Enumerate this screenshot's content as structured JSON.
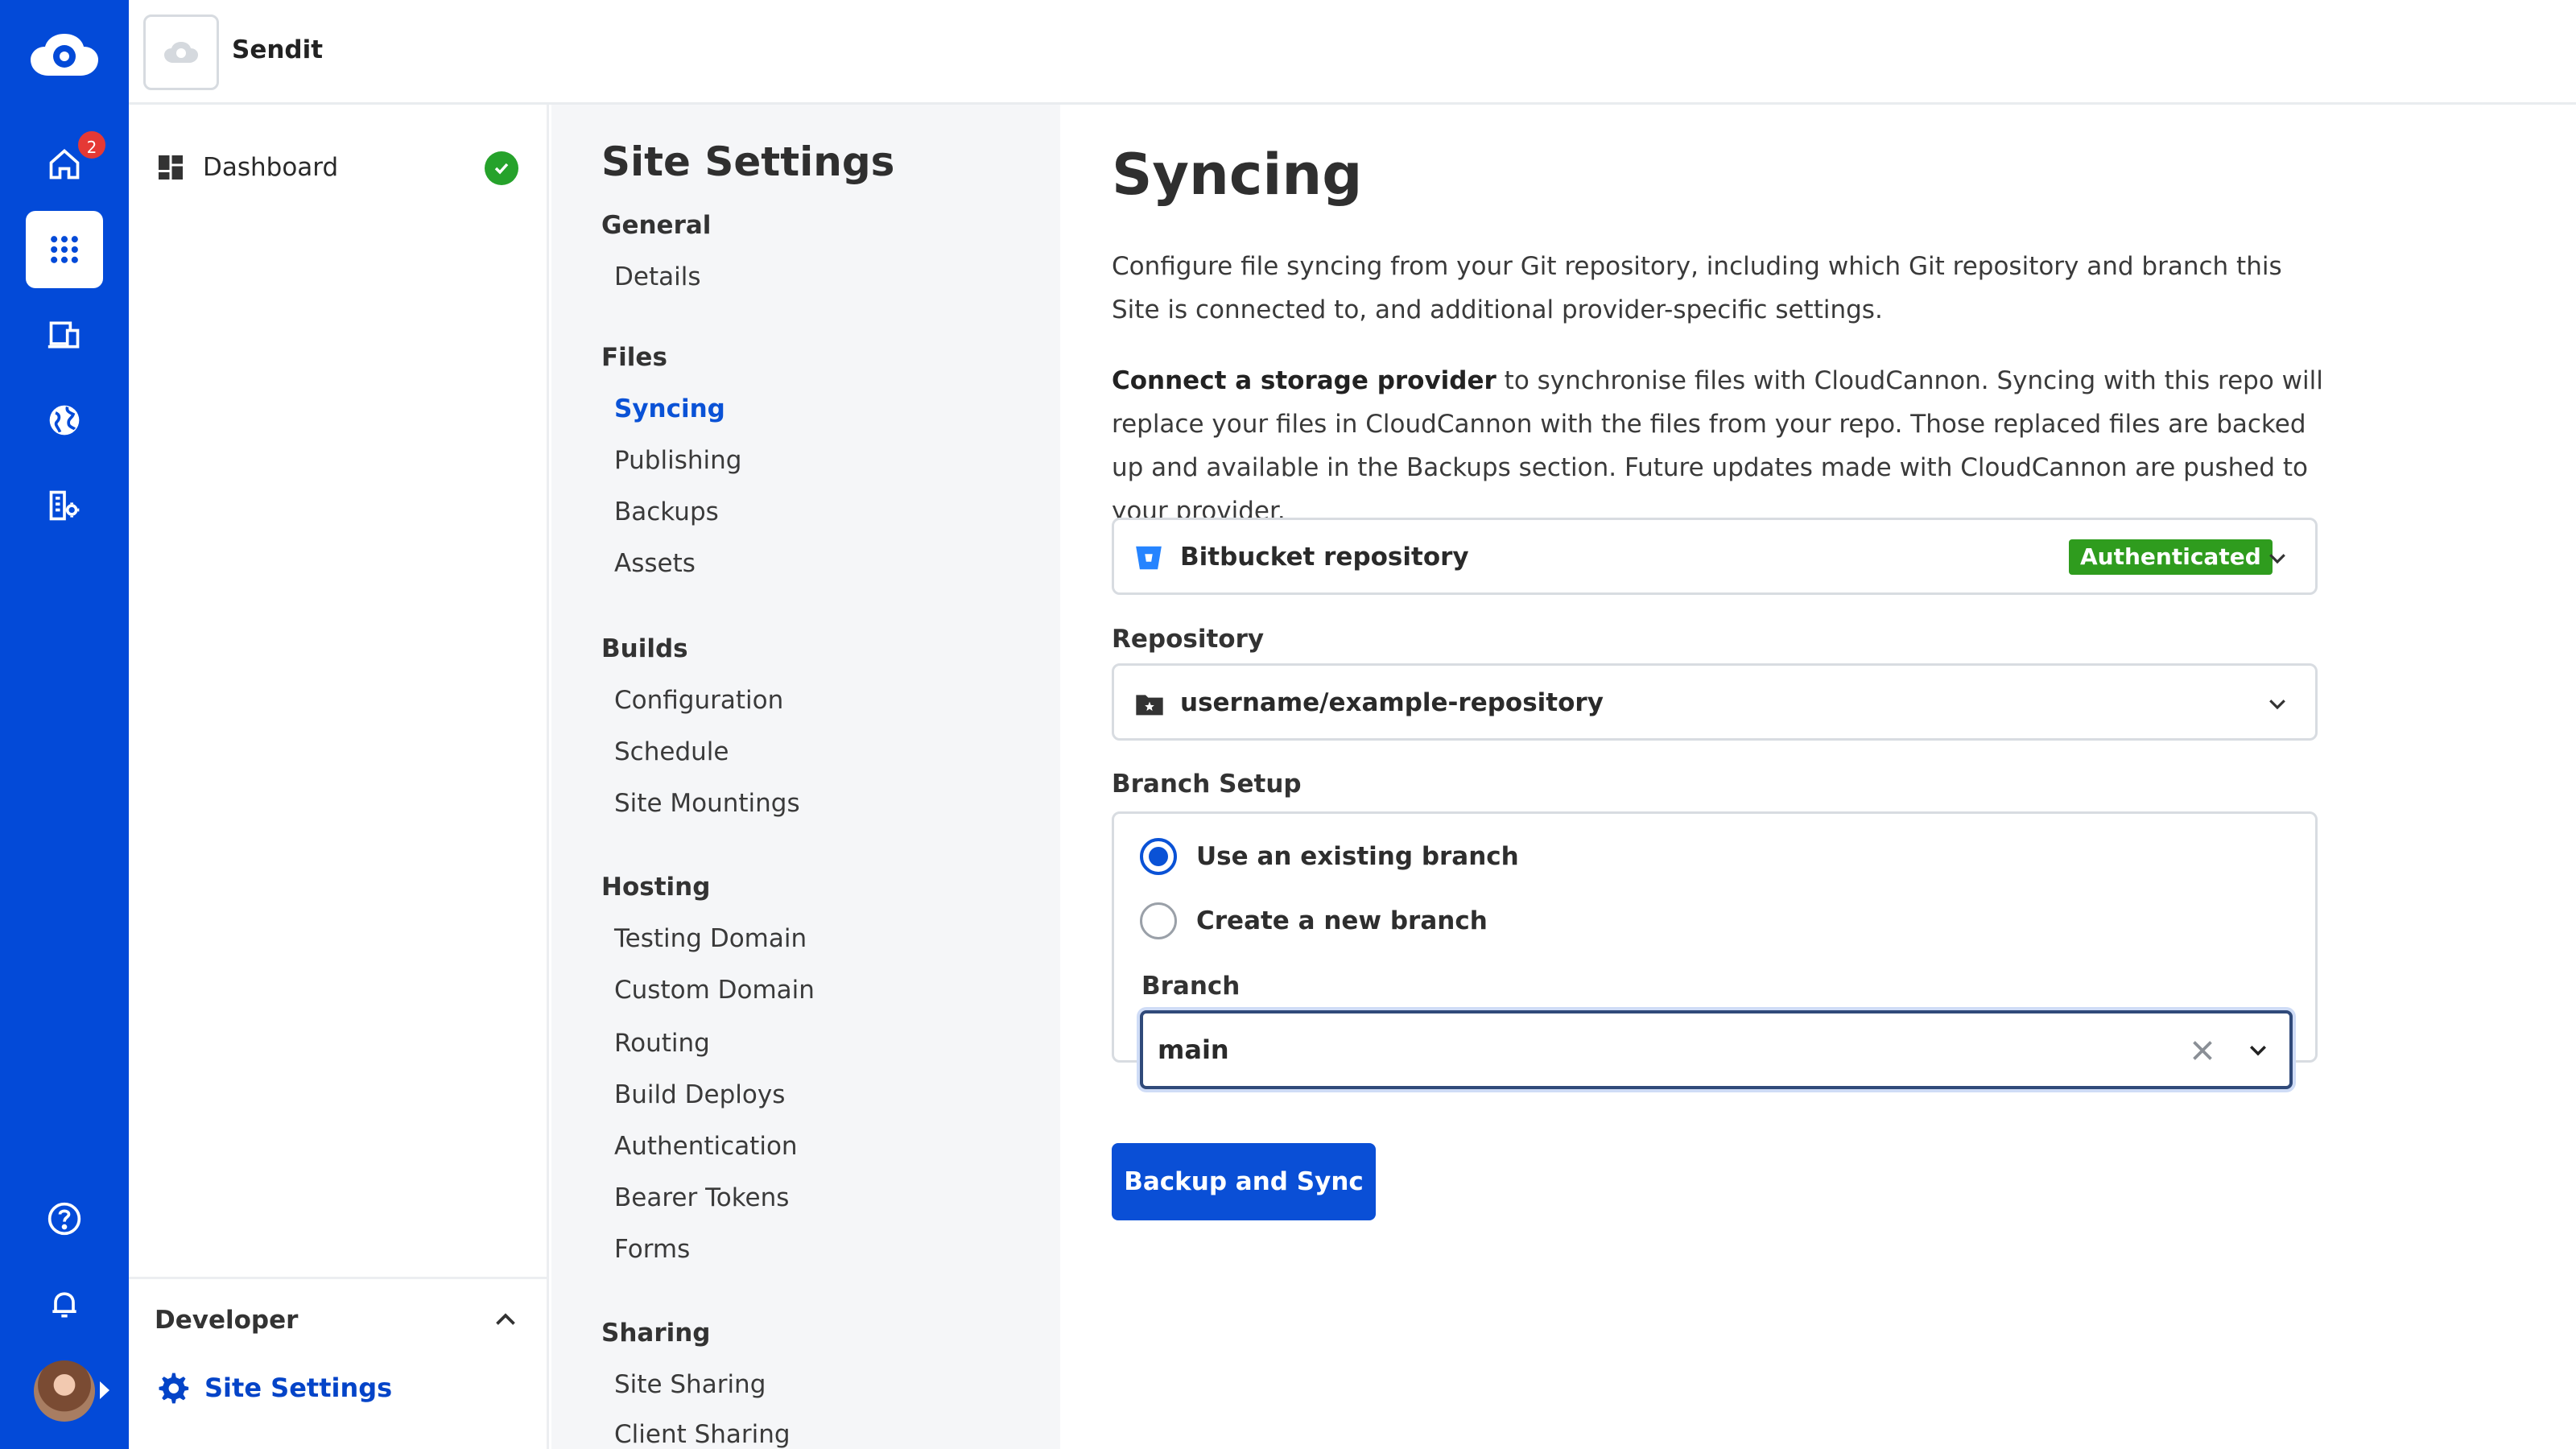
{
  "topbar": {
    "site_name": "Sendit"
  },
  "rail": {
    "home_badge": "2"
  },
  "left": {
    "dashboard_label": "Dashboard",
    "developer_title": "Developer",
    "site_settings_label": "Site Settings"
  },
  "nav": {
    "title": "Site Settings",
    "sections": [
      {
        "title": "General",
        "items": [
          "Details"
        ]
      },
      {
        "title": "Files",
        "items": [
          "Syncing",
          "Publishing",
          "Backups",
          "Assets"
        ]
      },
      {
        "title": "Builds",
        "items": [
          "Configuration",
          "Schedule",
          "Site Mountings"
        ]
      },
      {
        "title": "Hosting",
        "items": [
          "Testing Domain",
          "Custom Domain",
          "Routing",
          "Build Deploys",
          "Authentication",
          "Bearer Tokens",
          "Forms"
        ]
      },
      {
        "title": "Sharing",
        "items": [
          "Site Sharing",
          "Client Sharing"
        ]
      }
    ],
    "active_item": "Syncing"
  },
  "main": {
    "title": "Syncing",
    "intro": "Configure file syncing from your Git repository, including which Git repository and branch this Site is connected to, and additional provider-specific settings.",
    "connect_bold": "Connect a storage provider",
    "connect_rest": " to synchronise files with CloudCannon. Syncing with this repo will replace your files in CloudCannon with the files from your repo. Those replaced files are backed up and available in the Backups section. Future updates made with CloudCannon are pushed to your provider.",
    "provider_label": "Bitbucket repository",
    "provider_status": "Authenticated",
    "repository_label": "Repository",
    "repository_value": "username/example-repository",
    "branch_setup_label": "Branch Setup",
    "radio_existing": "Use an existing branch",
    "radio_new": "Create a new branch",
    "branch_label": "Branch",
    "branch_value": "main",
    "primary_button": "Backup and Sync"
  },
  "colors": {
    "rail": "#034ad8",
    "accent": "#0a52d6",
    "success": "#2f9c1e"
  }
}
